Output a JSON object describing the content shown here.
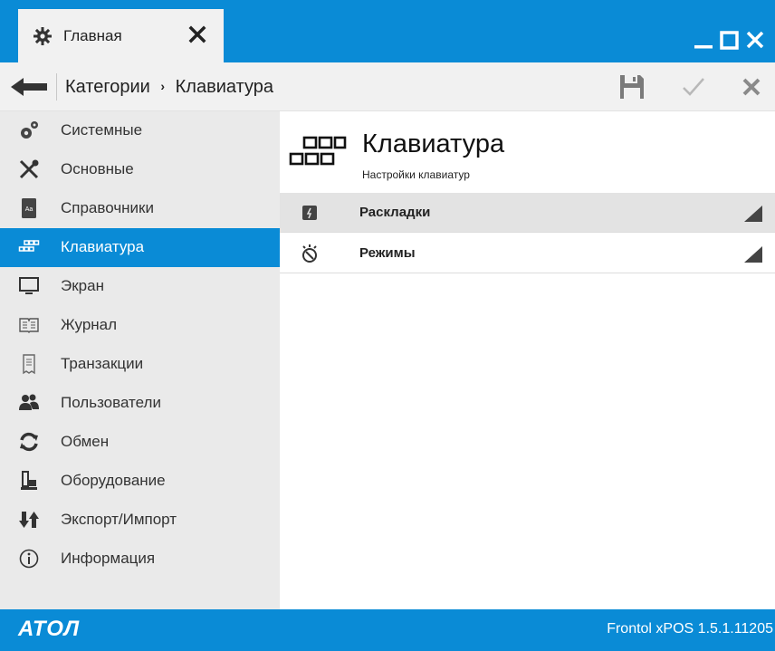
{
  "window": {
    "tab_label": "Главная",
    "tab_icon": "gear-icon",
    "controls": [
      "minimize-icon",
      "maximize-icon",
      "close-icon"
    ]
  },
  "navbar": {
    "breadcrumb_parent": "Категории",
    "breadcrumb_separator": "›",
    "breadcrumb_current": "Клавиатура",
    "tools": [
      "save-icon",
      "check-icon",
      "cancel-icon"
    ]
  },
  "sidebar": {
    "items": [
      {
        "label": "Системные",
        "icon": "gears-icon",
        "active": false
      },
      {
        "label": "Основные",
        "icon": "tools-icon",
        "active": false
      },
      {
        "label": "Справочники",
        "icon": "book-icon",
        "active": false
      },
      {
        "label": "Клавиатура",
        "icon": "keyboard-icon",
        "active": true
      },
      {
        "label": "Экран",
        "icon": "monitor-icon",
        "active": false
      },
      {
        "label": "Журнал",
        "icon": "journal-icon",
        "active": false
      },
      {
        "label": "Транзакции",
        "icon": "receipt-icon",
        "active": false
      },
      {
        "label": "Пользователи",
        "icon": "users-icon",
        "active": false
      },
      {
        "label": "Обмен",
        "icon": "sync-icon",
        "active": false
      },
      {
        "label": "Оборудование",
        "icon": "equipment-icon",
        "active": false
      },
      {
        "label": "Экспорт/Импорт",
        "icon": "export-import-icon",
        "active": false
      },
      {
        "label": "Информация",
        "icon": "info-icon",
        "active": false
      }
    ]
  },
  "main": {
    "title": "Клавиатура",
    "subtitle": "Настройки клавиатур",
    "icon": "keyboard-icon",
    "rows": [
      {
        "label": "Раскладки",
        "icon": "layout-icon",
        "selected": true
      },
      {
        "label": "Режимы",
        "icon": "timer-icon",
        "selected": false
      }
    ]
  },
  "footer": {
    "logo": "АТОЛ",
    "version": "Frontol xPOS 1.5.1.11205"
  },
  "colors": {
    "accent": "#0a8bd6",
    "sidebar_bg": "#eaeaea",
    "toolbar_bg": "#f1f1f1",
    "selected_row": "#e3e3e3"
  }
}
